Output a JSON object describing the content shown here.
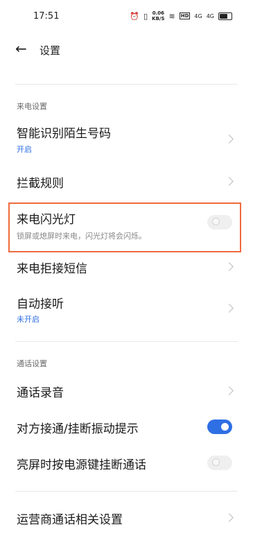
{
  "status": {
    "time": "17:51",
    "speed_top": "0.06",
    "speed_bottom": "KB/S",
    "hd": "HD",
    "sig1": "4G",
    "sig2": "4G"
  },
  "header": {
    "title": "设置"
  },
  "sections": {
    "incoming": "来电设置",
    "call": "通话设置"
  },
  "rows": {
    "smart_id": {
      "label": "智能识别陌生号码",
      "sub": "开启"
    },
    "block_rules": {
      "label": "拦截规则"
    },
    "flash": {
      "label": "来电闪光灯",
      "sub": "锁屏或熄屏时来电，闪光灯将会闪烁。",
      "enabled": false
    },
    "reject_sms": {
      "label": "来电拒接短信"
    },
    "auto_answer": {
      "label": "自动接听",
      "sub": "未开启"
    },
    "record": {
      "label": "通话录音"
    },
    "vibrate": {
      "label": "对方接通/挂断振动提示",
      "enabled": true
    },
    "power_end": {
      "label": "亮屏时按电源键挂断通话",
      "enabled": false
    },
    "carrier": {
      "label": "运营商通话相关设置"
    }
  },
  "colors": {
    "accent": "#2f6fe4",
    "highlight": "#ee6a3c"
  }
}
